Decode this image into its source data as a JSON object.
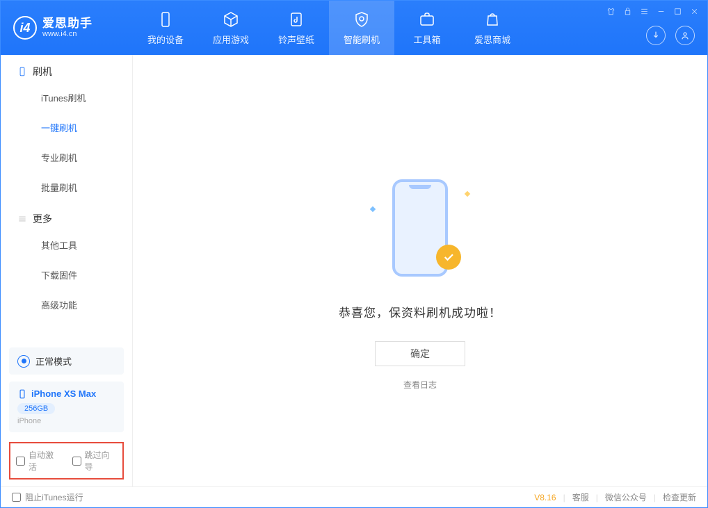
{
  "app": {
    "name_cn": "爱思助手",
    "name_en": "www.i4.cn"
  },
  "nav": [
    {
      "label": "我的设备"
    },
    {
      "label": "应用游戏"
    },
    {
      "label": "铃声壁纸"
    },
    {
      "label": "智能刷机",
      "active": true
    },
    {
      "label": "工具箱"
    },
    {
      "label": "爱思商城"
    }
  ],
  "sidebar": {
    "group1": {
      "title": "刷机",
      "items": [
        "iTunes刷机",
        "一键刷机",
        "专业刷机",
        "批量刷机"
      ],
      "activeIndex": 1
    },
    "group2": {
      "title": "更多",
      "items": [
        "其他工具",
        "下载固件",
        "高级功能"
      ]
    },
    "status": "正常模式",
    "device": {
      "name": "iPhone XS Max",
      "capacity": "256GB",
      "type": "iPhone"
    },
    "opts": {
      "auto_activate": "自动激活",
      "skip_guide": "跳过向导"
    }
  },
  "main": {
    "message": "恭喜您，保资料刷机成功啦！",
    "ok": "确定",
    "view_log": "查看日志"
  },
  "footer": {
    "block_itunes": "阻止iTunes运行",
    "version": "V8.16",
    "support": "客服",
    "wechat": "微信公众号",
    "update": "检查更新"
  }
}
